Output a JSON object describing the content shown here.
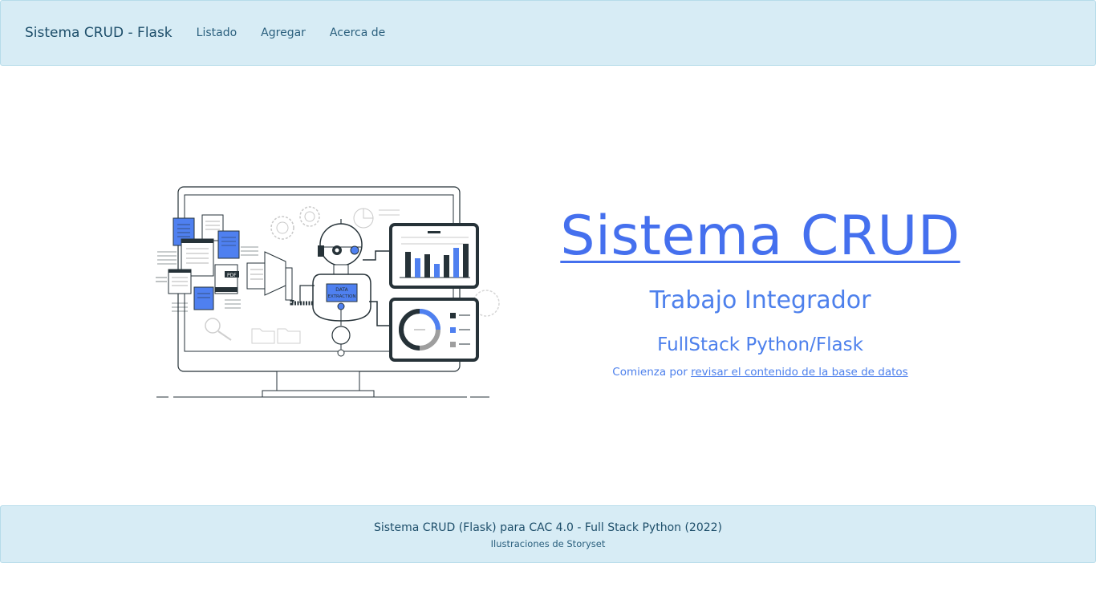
{
  "navbar": {
    "brand": "Sistema CRUD - Flask",
    "links": [
      "Listado",
      "Agregar",
      "Acerca de"
    ]
  },
  "illustration": {
    "badge_line1": "DATA",
    "badge_line2": "EXTRACTION",
    "pdf_label": "PDF",
    "colors": {
      "accent": "#4f80f0",
      "dark": "#263238",
      "gray": "#9e9e9e"
    }
  },
  "hero": {
    "title": "Sistema CRUD",
    "subtitle": "Trabajo Integrador",
    "subtitle2": "FullStack Python/Flask",
    "cta_prefix": "Comienza por",
    "cta_link": "revisar el contenido de la base de datos"
  },
  "footer": {
    "line1": "Sistema CRUD (Flask) para CAC 4.0 - Full Stack Python (2022)",
    "line2": "Ilustraciones de Storyset"
  }
}
